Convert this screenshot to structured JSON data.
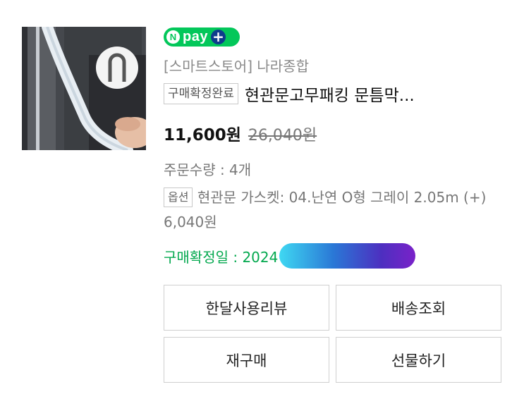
{
  "product": {
    "image_alt": "product-thumbnail",
    "pay_badge": {
      "n": "N",
      "text": "pay",
      "plus": "+"
    },
    "store": "[스마트스토어] 나라종합",
    "status_badge": "구매확정완료",
    "title": "현관문고무패킹 문틈막...",
    "price": "11,600원",
    "original_price": "26,040원",
    "quantity": "주문수량 : 4개",
    "option_label": "옵션",
    "option_text": "현관문 가스켓: 04.난연 O형 그레이 2.05m (+) 6,040원",
    "confirm_date": "구매확정일 : 2024"
  },
  "actions": {
    "review": "한달사용리뷰",
    "tracking": "배송조회",
    "rebuy": "재구매",
    "gift": "선물하기"
  },
  "colors": {
    "npay_green": "#03c75a",
    "confirm_green": "#03a84e"
  }
}
